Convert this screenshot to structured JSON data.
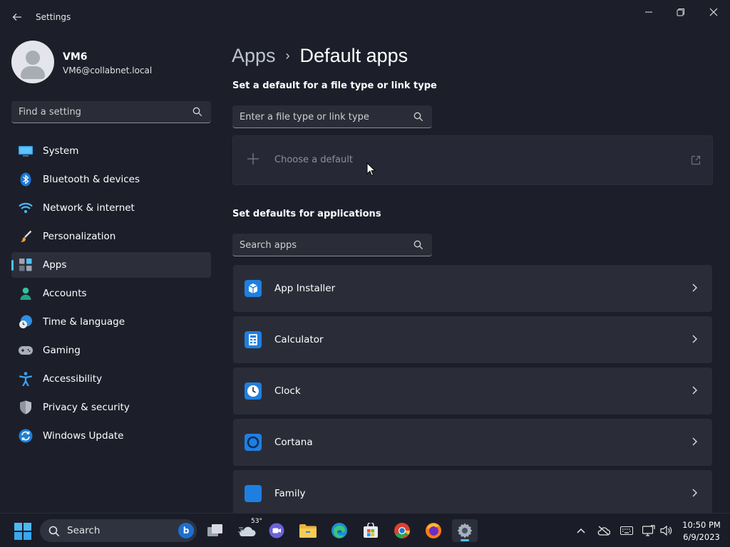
{
  "window": {
    "title": "Settings",
    "back_icon": "back-arrow-icon"
  },
  "user": {
    "name": "VM6",
    "email": "VM6@collabnet.local"
  },
  "sidebar": {
    "search_placeholder": "Find a setting",
    "items": [
      {
        "label": "System",
        "icon": "monitor-icon",
        "active": false
      },
      {
        "label": "Bluetooth & devices",
        "icon": "bluetooth-icon",
        "active": false
      },
      {
        "label": "Network & internet",
        "icon": "wifi-icon",
        "active": false
      },
      {
        "label": "Personalization",
        "icon": "paintbrush-icon",
        "active": false
      },
      {
        "label": "Apps",
        "icon": "apps-icon",
        "active": true
      },
      {
        "label": "Accounts",
        "icon": "person-icon",
        "active": false
      },
      {
        "label": "Time & language",
        "icon": "globe-clock-icon",
        "active": false
      },
      {
        "label": "Gaming",
        "icon": "gamepad-icon",
        "active": false
      },
      {
        "label": "Accessibility",
        "icon": "accessibility-icon",
        "active": false
      },
      {
        "label": "Privacy & security",
        "icon": "shield-icon",
        "active": false
      },
      {
        "label": "Windows Update",
        "icon": "update-icon",
        "active": false
      }
    ]
  },
  "breadcrumb": {
    "parent": "Apps",
    "separator": "›",
    "current": "Default apps"
  },
  "file_type_section": {
    "title": "Set a default for a file type or link type",
    "search_placeholder": "Enter a file type or link type",
    "choose_default_label": "Choose a default"
  },
  "apps_section": {
    "title": "Set defaults for applications",
    "search_placeholder": "Search apps",
    "apps": [
      {
        "name": "App Installer",
        "icon": "app-installer-icon"
      },
      {
        "name": "Calculator",
        "icon": "calculator-icon"
      },
      {
        "name": "Clock",
        "icon": "clock-icon"
      },
      {
        "name": "Cortana",
        "icon": "cortana-icon"
      },
      {
        "name": "Family",
        "icon": "family-icon"
      }
    ]
  },
  "taskbar": {
    "search_label": "Search",
    "weather_temp": "53°",
    "time": "10:50 PM",
    "date": "6/9/2023"
  },
  "colors": {
    "accent": "#4cc2ff",
    "background": "#1c1f2a",
    "card": "#2a2d38"
  }
}
